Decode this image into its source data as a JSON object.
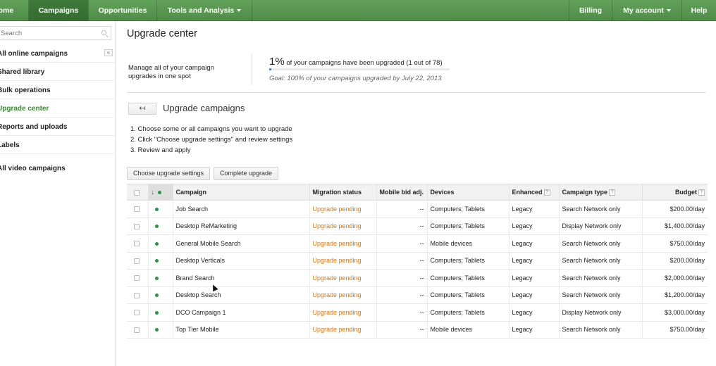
{
  "nav": {
    "home": "Home",
    "campaigns": "Campaigns",
    "opportunities": "Opportunities",
    "tools": "Tools and Analysis",
    "billing": "Billing",
    "account": "My account",
    "help": "Help"
  },
  "sidebar": {
    "search_placeholder": "Search",
    "collapse_label": "«",
    "items": [
      {
        "label": "All online campaigns"
      },
      {
        "label": "Shared library"
      },
      {
        "label": "Bulk operations"
      },
      {
        "label": "Upgrade center"
      },
      {
        "label": "Reports and uploads"
      },
      {
        "label": "Labels"
      },
      {
        "label": "All video campaigns"
      }
    ]
  },
  "main": {
    "title": "Upgrade center",
    "summary_text": "Manage all of your campaign upgrades in one spot",
    "progress_pct_label": "1%",
    "progress_text": "of your campaigns have been upgraded (1 out of 78)",
    "progress_fraction": 0.01,
    "goal_text": "Goal: 100% of your campaigns upgraded by July 22, 2013",
    "section_title": "Upgrade campaigns",
    "back_label": "↤",
    "steps": [
      "1.  Choose some or all campaigns you want to upgrade",
      "2.  Click \"Choose upgrade settings\" and review settings",
      "3.  Review and apply"
    ],
    "choose_button": "Choose upgrade settings",
    "complete_button": "Complete upgrade"
  },
  "table": {
    "headers": {
      "campaign": "Campaign",
      "migration": "Migration status",
      "mobile_bid": "Mobile bid adj.",
      "devices": "Devices",
      "enhanced": "Enhanced",
      "campaign_type": "Campaign type",
      "budget": "Budget",
      "help_glyph": "?"
    },
    "rows": [
      {
        "campaign": "Job Search",
        "status": "Upgrade pending",
        "bid": "--",
        "devices": "Computers; Tablets",
        "enhanced": "Legacy",
        "type": "Search Network only",
        "budget": "$200.00/day"
      },
      {
        "campaign": "Desktop ReMarketing",
        "status": "Upgrade pending",
        "bid": "--",
        "devices": "Computers; Tablets",
        "enhanced": "Legacy",
        "type": "Display Network only",
        "budget": "$1,400.00/day"
      },
      {
        "campaign": "General Mobile Search",
        "status": "Upgrade pending",
        "bid": "--",
        "devices": "Mobile devices",
        "enhanced": "Legacy",
        "type": "Search Network only",
        "budget": "$750.00/day"
      },
      {
        "campaign": "Desktop Verticals",
        "status": "Upgrade pending",
        "bid": "--",
        "devices": "Computers; Tablets",
        "enhanced": "Legacy",
        "type": "Search Network only",
        "budget": "$200.00/day"
      },
      {
        "campaign": "Brand Search",
        "status": "Upgrade pending",
        "bid": "--",
        "devices": "Computers; Tablets",
        "enhanced": "Legacy",
        "type": "Search Network only",
        "budget": "$2,000.00/day"
      },
      {
        "campaign": "Desktop Search",
        "status": "Upgrade pending",
        "bid": "--",
        "devices": "Computers; Tablets",
        "enhanced": "Legacy",
        "type": "Search Network only",
        "budget": "$1,200.00/day"
      },
      {
        "campaign": "DCO Campaign 1",
        "status": "Upgrade pending",
        "bid": "--",
        "devices": "Computers; Tablets",
        "enhanced": "Legacy",
        "type": "Display Network only",
        "budget": "$3,000.00/day"
      },
      {
        "campaign": "Top Tier Mobile",
        "status": "Upgrade pending",
        "bid": "--",
        "devices": "Mobile devices",
        "enhanced": "Legacy",
        "type": "Search Network only",
        "budget": "$750.00/day"
      }
    ]
  },
  "colors": {
    "nav_green": "#4f8c48",
    "active_link": "#3c8a34",
    "pending_orange": "#d77a17",
    "status_dot": "#27944a"
  }
}
